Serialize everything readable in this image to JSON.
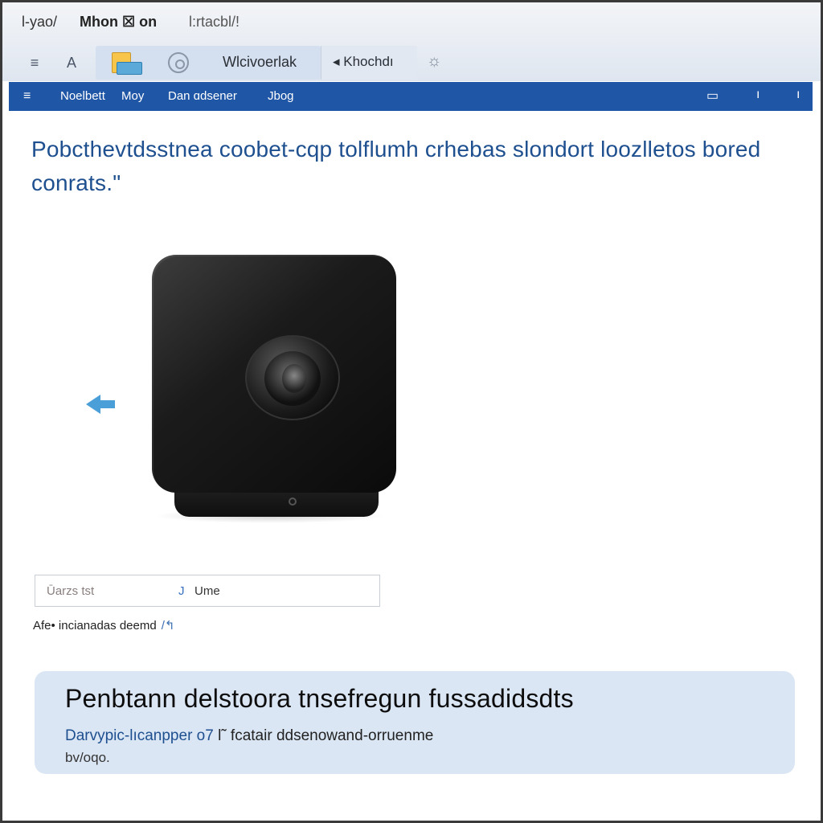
{
  "menu": {
    "items": [
      "l-yao/",
      "Mhon ☒ on",
      "l:rtacbl/!"
    ]
  },
  "toolbar": {
    "menu_icon": "≡",
    "up_icon": "A",
    "label1": "Wlcivoerlak",
    "label2": "◂ Khochdı",
    "sun_icon": "☼"
  },
  "navbar": {
    "hamburger": "≡",
    "items": [
      "Noelbett",
      "Moy",
      "Dan ɑdsener",
      "Jbog"
    ],
    "controls": [
      "▭",
      "ı",
      "ı"
    ],
    "color": "#1f56a6"
  },
  "intro": {
    "text": "Pobcthevtdsstnea coobet-cqp tolflumh crhebas slondort loozlletos bored conrats.\""
  },
  "product": {
    "image_label": "black square camera device",
    "arrow_icon": "arrow-icon"
  },
  "field": {
    "placeholder": "Ūarzs tst",
    "separator": "J",
    "value": "Ume"
  },
  "caption": {
    "text": "Afe• incianadas deemd",
    "icon": "/↰"
  },
  "card": {
    "title": "Penbtann delstoora tnsefregun fussadidsdts",
    "subtitle": "Darvypic-lıcanpper o7",
    "subtitle_rest": "l˜ fcatair ddsenowand-orruenme",
    "note": "bv/oqo."
  }
}
